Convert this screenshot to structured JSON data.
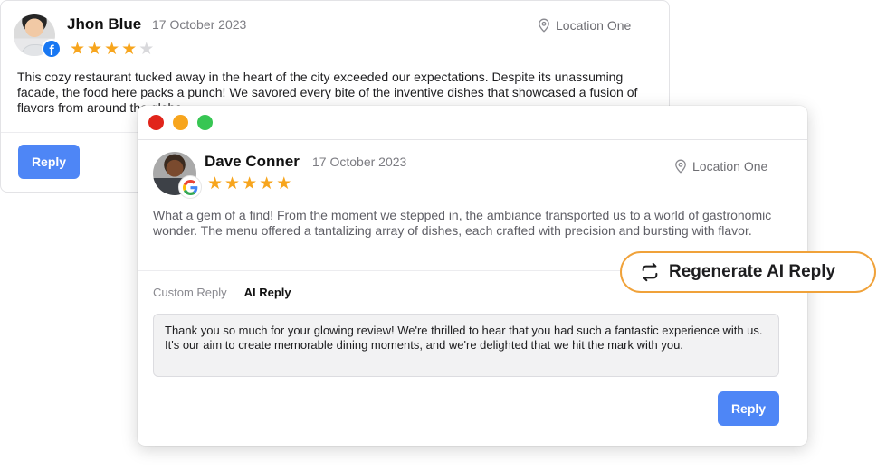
{
  "back_review": {
    "name": "Jhon Blue",
    "date": "17 October 2023",
    "location": "Location One",
    "source_icon": "facebook-icon",
    "rating": 4,
    "max_rating": 5,
    "text": "This cozy restaurant tucked away in the heart of the city exceeded our expectations. Despite its unassuming facade, the food here packs a punch! We savored every bite of the inventive dishes that showcased a fusion of flavors from around the globe.",
    "reply_label": "Reply"
  },
  "front_review": {
    "name": "Dave Conner",
    "date": "17 October 2023",
    "location": "Location One",
    "source_icon": "google-icon",
    "rating": 5,
    "max_rating": 5,
    "text": "What a gem of a find! From the moment we stepped in, the ambiance transported us to a world of gastronomic wonder. The menu offered a tantalizing array of dishes, each crafted with precision and bursting with flavor.",
    "tabs": [
      {
        "label": "Custom Reply",
        "active": false
      },
      {
        "label": "AI Reply",
        "active": true
      }
    ],
    "ai_reply_text": "Thank you so much for your glowing review! We're thrilled to hear that you had such a fantastic experience with us. It's our aim to create memorable dining moments, and we're delighted that we hit the mark with you.",
    "reply_label": "Reply"
  },
  "regenerate_label": "Regenerate AI Reply",
  "colors": {
    "accent_blue": "#4e86f6",
    "star": "#f7a51d",
    "regen_border": "#f0a23a"
  }
}
